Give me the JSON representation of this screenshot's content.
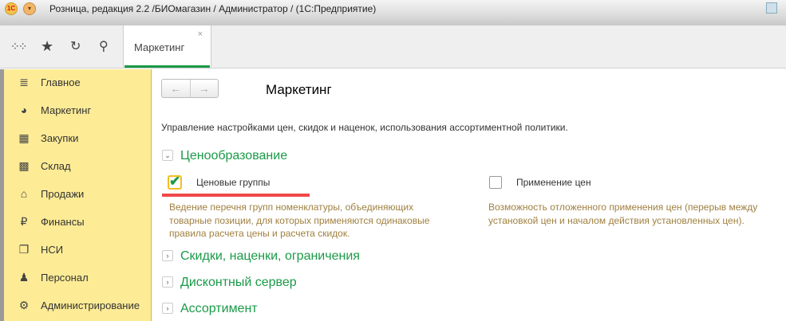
{
  "window": {
    "title": "Розница, редакция 2.2 /БИОмагазин / Администратор /  (1С:Предприятие)",
    "logo": "1С"
  },
  "toolbar": {
    "icons": [
      "apps-grid-icon",
      "star-icon",
      "history-icon",
      "search-icon"
    ]
  },
  "tab": {
    "label": "Маркетинг",
    "close": "×"
  },
  "sidebar": {
    "items": [
      {
        "label": "Главное",
        "icon": "≣"
      },
      {
        "label": "Маркетинг",
        "icon": "◕"
      },
      {
        "label": "Закупки",
        "icon": "▦"
      },
      {
        "label": "Склад",
        "icon": "▩"
      },
      {
        "label": "Продажи",
        "icon": "⌂"
      },
      {
        "label": "Финансы",
        "icon": "₽"
      },
      {
        "label": "НСИ",
        "icon": "❐"
      },
      {
        "label": "Персонал",
        "icon": "♟"
      },
      {
        "label": "Администрирование",
        "icon": "⚙"
      }
    ]
  },
  "page": {
    "title": "Маркетинг",
    "back": "←",
    "forward": "→",
    "description": "Управление настройками цен, скидок и наценок, использования ассортиментной политики."
  },
  "sections": [
    {
      "title": "Ценообразование",
      "expanded": true
    },
    {
      "title": "Скидки, наценки, ограничения",
      "expanded": false
    },
    {
      "title": "Дисконтный сервер",
      "expanded": false
    },
    {
      "title": "Ассортимент",
      "expanded": false
    }
  ],
  "options": [
    {
      "label": "Ценовые группы",
      "checked": true,
      "hint": [
        "Ведение перечня групп номенклатуры, объединяющих",
        "товарные позиции, для которых применяются одинаковые",
        "правила расчета цены и расчета скидок."
      ]
    },
    {
      "label": "Применение цен",
      "checked": false,
      "hint": [
        "Возможность отложенного применения цен (перерыв между",
        "установкой цен и началом действия установленных цен)."
      ]
    }
  ],
  "colors": {
    "accent": "#1a9a47",
    "sidebar": "#fdeb96",
    "highlight": "#f04848"
  }
}
